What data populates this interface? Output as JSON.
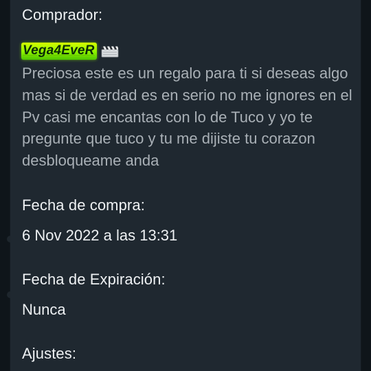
{
  "purchase": {
    "buyer_label": "Comprador:",
    "buyer_name": "Vega4EveR",
    "buyer_badge_icon": "clapperboard-icon",
    "message": "Preciosa este es un regalo para ti si deseas algo mas si de verdad es en serio no me ignores en el Pv casi me encantas con lo de Tuco y yo te pregunte que tuco y tu me dijiste tu corazon desbloqueame anda",
    "purchase_date_label": "Fecha de compra:",
    "purchase_date_value": "6 Nov 2022 a las 13:31",
    "expiration_label": "Fecha de Expiración:",
    "expiration_value": "Nunca",
    "settings_label": "Ajustes:"
  },
  "colors": {
    "card_background": "#1f2830",
    "page_background": "#131a20",
    "primary_text": "#eef1f3",
    "message_text": "#a9b0b6",
    "buyer_name_highlight": "#8cf200"
  }
}
